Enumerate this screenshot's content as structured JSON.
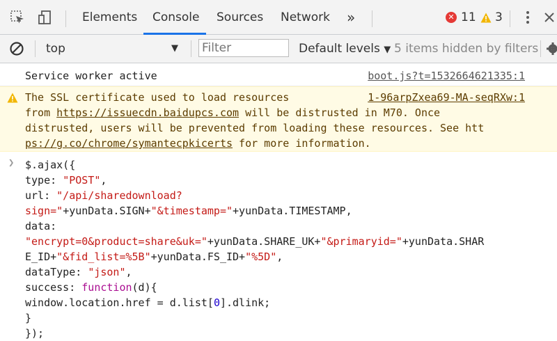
{
  "tabs": [
    {
      "label": "Elements"
    },
    {
      "label": "Console"
    },
    {
      "label": "Sources"
    },
    {
      "label": "Network"
    }
  ],
  "more_tabs_glyph": "»",
  "counters": {
    "errors": "11",
    "warnings": "3"
  },
  "toolbar": {
    "context": "top",
    "filter_placeholder": "Filter",
    "levels": "Default levels",
    "hidden": "5 items hidden by filters"
  },
  "messages": {
    "sw": {
      "text": "Service worker active",
      "source": "boot.js?t=1532664621335:1"
    },
    "ssl": {
      "source": "1-96arpZxea69-MA-seqRXw:1",
      "l1": "The SSL certificate used to load resources",
      "l2_pre": "from ",
      "l2_link": "https://issuecdn.baidupcs.com",
      "l2_post": " will be distrusted in M70. Once",
      "l3": "distrusted, users will be prevented from loading these resources. See htt",
      "l4_link": "ps://g.co/chrome/symantecpkicerts",
      "l4_post": " for more information."
    }
  },
  "code": {
    "l1": "$.ajax({",
    "l2_a": "type: ",
    "l2_b": "\"POST\"",
    "l2_c": ",",
    "l3_a": "url: ",
    "l3_b": "\"/api/sharedownload?",
    "l4_a": "sign=\"",
    "l4_b": "+yunData.SIGN+",
    "l4_c": "\"&timestamp=\"",
    "l4_d": "+yunData.TIMESTAMP,",
    "l5": "data:",
    "l6_a": "\"encrypt=0&product=share&uk=\"",
    "l6_b": "+yunData.SHARE_UK+",
    "l6_c": "\"&primaryid=\"",
    "l6_d": "+yunData.SHAR",
    "l7_a": "E_ID+",
    "l7_b": "\"&fid_list=%5B\"",
    "l7_c": "+yunData.FS_ID+",
    "l7_d": "\"%5D\"",
    "l7_e": ",",
    "l8_a": "dataType: ",
    "l8_b": "\"json\"",
    "l8_c": ",",
    "l9_a": "success: ",
    "l9_b": "function",
    "l9_c": "(d){",
    "l10_a": "window.location.href = d.list[",
    "l10_b": "0",
    "l10_c": "].dlink;",
    "l11": "}",
    "l12": "});"
  }
}
